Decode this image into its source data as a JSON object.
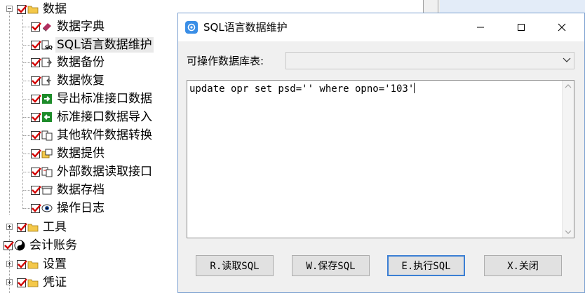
{
  "tree": {
    "root": {
      "label": "数据",
      "icon": "folder-icon"
    },
    "children": [
      {
        "label": "数据字典",
        "icon": "books-icon"
      },
      {
        "label": "SQL语言数据维护",
        "icon": "sql-icon",
        "selected": true
      },
      {
        "label": "数据备份",
        "icon": "backup-icon"
      },
      {
        "label": "数据恢复",
        "icon": "restore-icon"
      },
      {
        "label": "导出标准接口数据",
        "icon": "export-arrow-icon"
      },
      {
        "label": "标准接口数据导入",
        "icon": "import-arrow-icon"
      },
      {
        "label": "其他软件数据转换",
        "icon": "convert-icon"
      },
      {
        "label": "数据提供",
        "icon": "provide-icon"
      },
      {
        "label": "外部数据读取接口",
        "icon": "external-read-icon"
      },
      {
        "label": "数据存档",
        "icon": "archive-icon"
      },
      {
        "label": "操作日志",
        "icon": "eye-icon"
      }
    ],
    "siblings": [
      {
        "label": "工具",
        "icon": "folder-icon",
        "expander": "plus",
        "level": 1
      },
      {
        "label": "会计账务",
        "icon": "yin-yang-icon",
        "expander": "minus",
        "level": 0
      },
      {
        "label": "设置",
        "icon": "folder-icon",
        "expander": "plus",
        "level": 1
      },
      {
        "label": "凭证",
        "icon": "folder-icon",
        "expander": "plus",
        "level": 1
      }
    ]
  },
  "dialog": {
    "title": "SQL语言数据维护",
    "table_label": "可操作数据库表:",
    "table_select_value": "",
    "sql_text": "update opr set psd='' where opno='103'",
    "buttons": {
      "read": "R.读取SQL",
      "save": "W.保存SQL",
      "exec": "E.执行SQL",
      "close": "X.关闭"
    }
  },
  "colors": {
    "checkmark": "#d40000",
    "folder": "#f4c84a",
    "dialog_border": "#7a9fd0",
    "default_button_border": "#3b7fd4",
    "app_icon": "#3a8ee6"
  }
}
